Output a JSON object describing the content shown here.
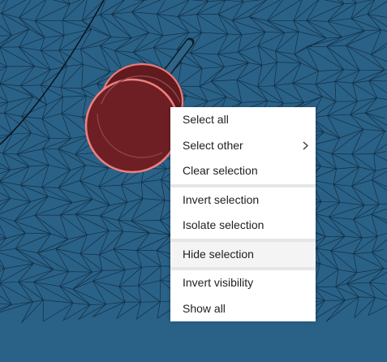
{
  "viewport": {
    "background": "#2a6187",
    "mesh_line": "#0d2738",
    "selected_fill": "#6a1c20",
    "selected_outline": "#f07070"
  },
  "context_menu": {
    "groups": [
      {
        "items": [
          {
            "label": "Select all",
            "name": "menu-item-select-all",
            "submenu": false,
            "highlighted": false
          },
          {
            "label": "Select other",
            "name": "menu-item-select-other",
            "submenu": true,
            "highlighted": false
          },
          {
            "label": "Clear selection",
            "name": "menu-item-clear-selection",
            "submenu": false,
            "highlighted": false
          }
        ]
      },
      {
        "items": [
          {
            "label": "Invert selection",
            "name": "menu-item-invert-selection",
            "submenu": false,
            "highlighted": false
          },
          {
            "label": "Isolate selection",
            "name": "menu-item-isolate-selection",
            "submenu": false,
            "highlighted": false
          }
        ]
      },
      {
        "items": [
          {
            "label": "Hide selection",
            "name": "menu-item-hide-selection",
            "submenu": false,
            "highlighted": true
          }
        ]
      },
      {
        "items": [
          {
            "label": "Invert visibility",
            "name": "menu-item-invert-visibility",
            "submenu": false,
            "highlighted": false
          },
          {
            "label": "Show all",
            "name": "menu-item-show-all",
            "submenu": false,
            "highlighted": false
          }
        ]
      }
    ],
    "submenu_icon": "chevron-right-icon"
  }
}
